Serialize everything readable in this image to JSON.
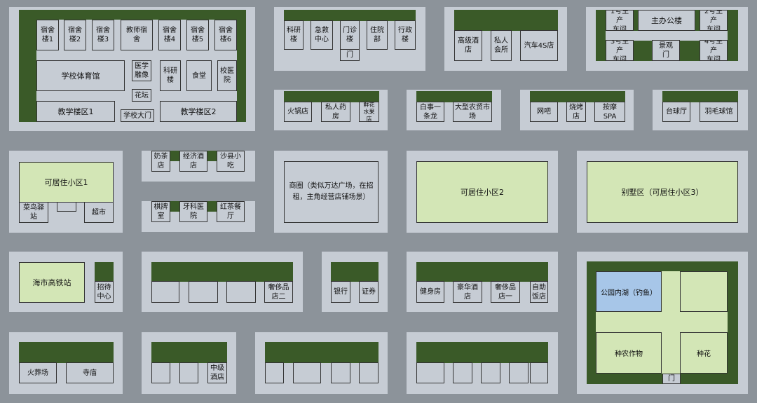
{
  "campus": {
    "dorm1": "宿舍\n楼1",
    "dorm2": "宿舍\n楼2",
    "dorm3": "宿舍\n楼3",
    "teacher_dorm": "教师宿\n舍",
    "dorm4": "宿舍\n楼4",
    "dorm5": "宿舍\n楼5",
    "dorm6": "宿舍\n楼6",
    "gym": "学校体育馆",
    "statue": "医学\n雕像",
    "science": "科研\n楼",
    "canteen": "食堂",
    "clinic": "校医\n院",
    "flower": "花坛",
    "teach1": "教学楼区1",
    "gate": "学校大门",
    "teach2": "教学楼区2"
  },
  "hospital": {
    "research": "科研\n楼",
    "emergency": "急救\n中心",
    "outpatient": "门诊\n楼",
    "inpatient": "住院\n部",
    "admin": "行政\n楼",
    "door": "门"
  },
  "hotel_block": {
    "hotel": "高级酒店",
    "club": "私人\n会所",
    "car": "汽车4S店"
  },
  "factory": {
    "f1": "1号生产\n车间",
    "office": "主办公楼",
    "f2": "2号生产\n车间",
    "f3": "3号生产\n车间",
    "view_gate": "景观\n门",
    "f4": "4号生产\n车间"
  },
  "row2": {
    "hotpot": "火锅店",
    "pharmacy": "私人药\n房",
    "fruit": "鲜花\n水果\n店",
    "baishi": "白事一\n条龙",
    "market": "大型农贸市\n场",
    "netcafe": "网吧",
    "bbq": "烧烤\n店",
    "spa": "按摩\nSPA",
    "billiards": "台球厅",
    "badminton": "羽毛球馆"
  },
  "row3": {
    "res1": "可居住小区1",
    "cainiao": "菜鸟驿站",
    "supermarket": "超市",
    "milktea": "奶茶\n店",
    "budget_hotel": "经济酒\n店",
    "shaxian": "沙县小\n吃",
    "chess": "棋牌\n室",
    "dental": "牙科医\n院",
    "tea": "红茶餐\n厅",
    "mall": "商圈（类似万达广场，在招\n租，主角经营店铺场景）",
    "res2": "可居住小区2",
    "villa": "别墅区（可居住小区3）"
  },
  "row4": {
    "station": "海市高铁站",
    "guest": "招待\n中心",
    "lux2": "奢侈品\n店二",
    "bank": "银行",
    "securities": "证券",
    "fitness": "健身房",
    "lux_hotel": "豪华酒\n店",
    "lux1": "奢侈品\n店一",
    "buffet": "自助\n饭店",
    "lake": "公园内湖（钓鱼）",
    "crops": "种农作物",
    "flowers": "种花",
    "park_gate": "门"
  },
  "row5": {
    "crematorium": "火葬场",
    "temple": "寺庙",
    "mid_hotel": "中级\n酒店"
  }
}
